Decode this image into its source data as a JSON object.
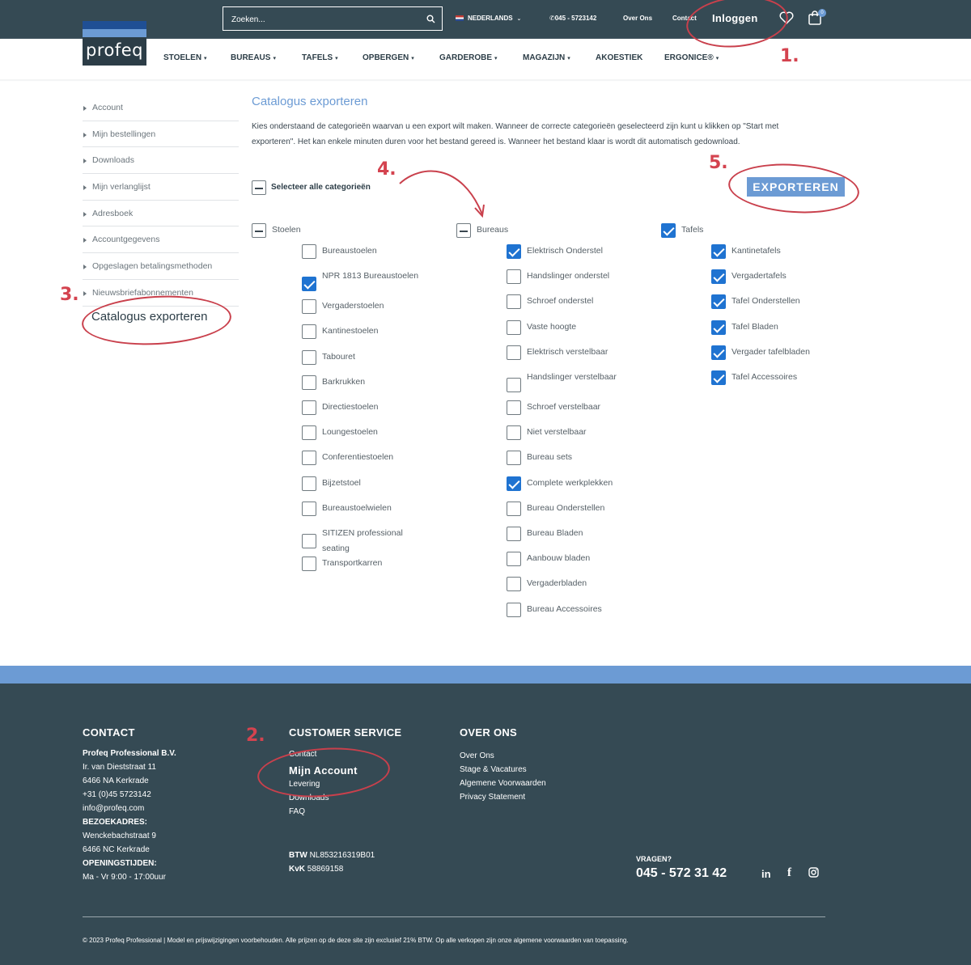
{
  "brand": {
    "logo": "profeq"
  },
  "topbar": {
    "search_placeholder": "Zoeken...",
    "language": "NEDERLANDS",
    "phone": "045 - 5723142",
    "over_ons": "Over Ons",
    "contact": "Contact",
    "login": "Inloggen",
    "cart_count": "0"
  },
  "nav": [
    "STOELEN",
    "BUREAUS",
    "TAFELS",
    "OPBERGEN",
    "GARDEROBE",
    "MAGAZIJN",
    "AKOESTIEK",
    "ERGONICE®"
  ],
  "sidebar": {
    "items": [
      "Account",
      "Mijn bestellingen",
      "Downloads",
      "Mijn verlanglijst",
      "Adresboek",
      "Accountgegevens",
      "Opgeslagen betalingsmethoden",
      "Nieuwsbriefabonnementen"
    ],
    "active": "Catalogus exporteren"
  },
  "content": {
    "title": "Catalogus exporteren",
    "description": "Kies onderstaand de categorieën waarvan u een export wilt maken. Wanneer de correcte categorieën geselecteerd zijn kunt u klikken op \"Start met exporteren\". Het kan enkele minuten duren voor het bestand gereed is. Wanneer het bestand klaar is wordt dit automatisch gedownload.",
    "export_button": "EXPORTEREN",
    "select_all": "Selecteer alle categorieën"
  },
  "categories": [
    {
      "name": "Stoelen",
      "state": "mixed",
      "items": [
        {
          "label": "Bureaustoelen",
          "checked": false
        },
        {
          "label": "NPR 1813 Bureaustoelen",
          "checked": true
        },
        {
          "label": "Vergaderstoelen",
          "checked": false
        },
        {
          "label": "Kantinestoelen",
          "checked": false
        },
        {
          "label": "Tabouret",
          "checked": false
        },
        {
          "label": "Barkrukken",
          "checked": false
        },
        {
          "label": "Directiestoelen",
          "checked": false
        },
        {
          "label": "Loungestoelen",
          "checked": false
        },
        {
          "label": "Conferentiestoelen",
          "checked": false
        },
        {
          "label": "Bijzetstoel",
          "checked": false
        },
        {
          "label": "Bureaustoelwielen",
          "checked": false
        },
        {
          "label": "SITIZEN professional seating",
          "checked": false
        },
        {
          "label": "Transportkarren",
          "checked": false
        }
      ]
    },
    {
      "name": "Bureaus",
      "state": "mixed",
      "items": [
        {
          "label": "Elektrisch Onderstel",
          "checked": true
        },
        {
          "label": "Handslinger onderstel",
          "checked": false
        },
        {
          "label": "Schroef onderstel",
          "checked": false
        },
        {
          "label": "Vaste hoogte",
          "checked": false
        },
        {
          "label": "Elektrisch verstelbaar",
          "checked": false
        },
        {
          "label": "Handslinger verstelbaar",
          "checked": false
        },
        {
          "label": "Schroef verstelbaar",
          "checked": false
        },
        {
          "label": "Niet verstelbaar",
          "checked": false
        },
        {
          "label": "Bureau sets",
          "checked": false
        },
        {
          "label": "Complete werkplekken",
          "checked": true
        },
        {
          "label": "Bureau Onderstellen",
          "checked": false
        },
        {
          "label": "Bureau Bladen",
          "checked": false
        },
        {
          "label": "Aanbouw bladen",
          "checked": false
        },
        {
          "label": "Vergaderbladen",
          "checked": false
        },
        {
          "label": "Bureau Accessoires",
          "checked": false
        }
      ]
    },
    {
      "name": "Tafels",
      "state": "checked",
      "items": [
        {
          "label": "Kantinetafels",
          "checked": true
        },
        {
          "label": "Vergadertafels",
          "checked": true
        },
        {
          "label": "Tafel Onderstellen",
          "checked": true
        },
        {
          "label": "Tafel Bladen",
          "checked": true
        },
        {
          "label": "Vergader tafelbladen",
          "checked": true
        },
        {
          "label": "Tafel Accessoires",
          "checked": true
        }
      ]
    }
  ],
  "annotations": {
    "a1": "1.",
    "a2": "2.",
    "a3": "3.",
    "a4": "4.",
    "a5": "5."
  },
  "footer": {
    "contact": {
      "heading": "CONTACT",
      "company": "Profeq Professional B.V.",
      "street": "Ir. van Dieststraat 11",
      "city": "6466 NA Kerkrade",
      "phone": "+31 (0)45 5723142",
      "email": "info@profeq.com",
      "visit_label": "BEZOEKADRES:",
      "visit_street": "Wenckebachstraat 9",
      "visit_city": "6466 NC Kerkrade",
      "hours_label": "OPENINGSTIJDEN:",
      "hours": "Ma - Vr 9:00 - 17:00uur"
    },
    "service": {
      "heading": "CUSTOMER SERVICE",
      "links": [
        "Contact",
        "Mijn Account",
        "Levering",
        "Downloads",
        "FAQ"
      ]
    },
    "about": {
      "heading": "OVER ONS",
      "links": [
        "Over Ons",
        "Stage & Vacatures",
        "Algemene Voorwaarden",
        "Privacy Statement"
      ]
    },
    "btw_label": "BTW",
    "btw": "NL853216319B01",
    "kvk_label": "KvK",
    "kvk": "58869158",
    "questions": "VRAGEN?",
    "questions_phone": "045 - 572 31 42",
    "social": {
      "linkedin": "in",
      "facebook": "f",
      "instagram": "instagram-icon"
    },
    "copyright": "© 2023 Profeq Professional | Model en prijswijzigingen voorbehouden. Alle prijzen op de deze site zijn exclusief 21% BTW. Op alle verkopen zijn onze algemene voorwaarden van toepassing."
  },
  "colors": {
    "dark": "#354a54",
    "accent": "#6c9bd4",
    "checkbox": "#1f73d1",
    "annotation": "#d4434f"
  }
}
